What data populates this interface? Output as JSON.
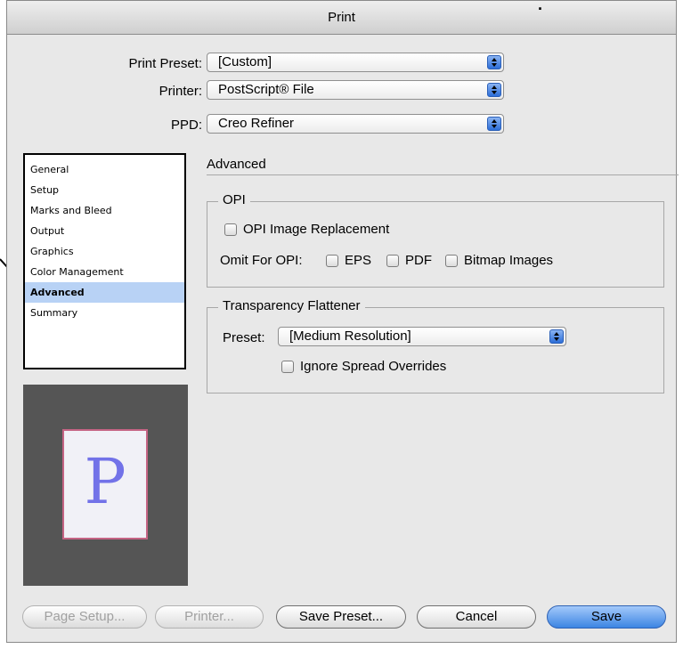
{
  "window": {
    "title": "Print"
  },
  "top_fields": {
    "print_preset": {
      "label": "Print Preset:",
      "value": "[Custom]"
    },
    "printer": {
      "label": "Printer:",
      "value": "PostScript® File"
    },
    "ppd": {
      "label": "PPD:",
      "value": "Creo Refiner"
    }
  },
  "sidebar": {
    "items": [
      {
        "label": "General"
      },
      {
        "label": "Setup"
      },
      {
        "label": "Marks and Bleed"
      },
      {
        "label": "Output"
      },
      {
        "label": "Graphics"
      },
      {
        "label": "Color Management"
      },
      {
        "label": "Advanced"
      },
      {
        "label": "Summary"
      }
    ],
    "selected": "Advanced"
  },
  "preview": {
    "letter": "P"
  },
  "panel": {
    "title": "Advanced",
    "opi": {
      "group_title": "OPI",
      "image_replacement": {
        "label": "OPI Image Replacement",
        "checked": false
      },
      "omit_label": "Omit For OPI:",
      "omit_eps": {
        "label": "EPS",
        "checked": false
      },
      "omit_pdf": {
        "label": "PDF",
        "checked": false
      },
      "omit_bitmap": {
        "label": "Bitmap Images",
        "checked": false
      }
    },
    "flattener": {
      "group_title": "Transparency Flattener",
      "preset_label": "Preset:",
      "preset_value": "[Medium Resolution]",
      "ignore_overrides": {
        "label": "Ignore Spread Overrides",
        "checked": false
      }
    }
  },
  "buttons": {
    "page_setup": "Page Setup...",
    "printer": "Printer...",
    "save_preset": "Save Preset...",
    "cancel": "Cancel",
    "save": "Save"
  }
}
